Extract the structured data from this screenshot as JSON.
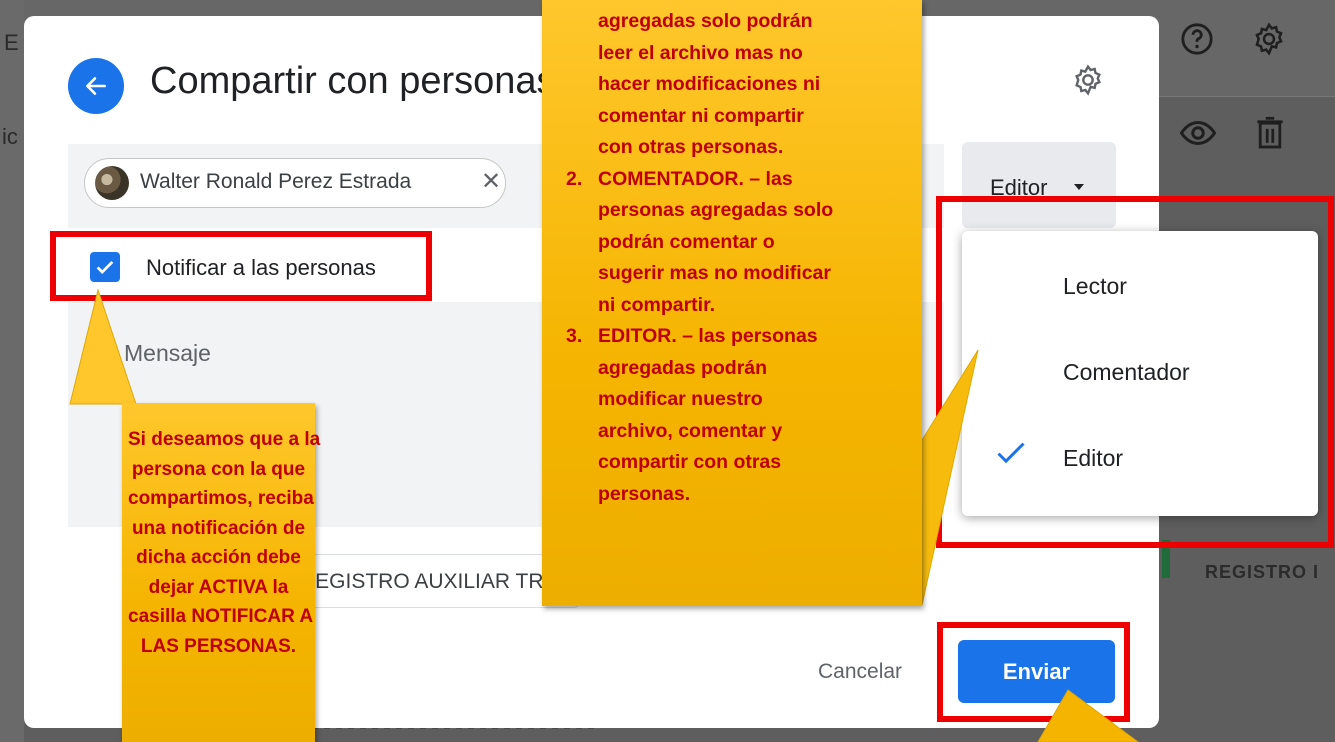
{
  "dialog": {
    "title": "Compartir con personas",
    "recipient_name": "Walter Ronald Perez Estrada",
    "role_value": "Editor",
    "notify_label": "Notificar a las personas",
    "message_placeholder": "Mensaje",
    "attachment_name": "REGISTRO AUXILIAR TRIMESTRE II.docx",
    "cancel_label": "Cancelar",
    "send_label": "Enviar",
    "notify_checked": true
  },
  "role_menu": {
    "items": [
      {
        "label": "Lector",
        "selected": false
      },
      {
        "label": "Comentador",
        "selected": false
      },
      {
        "label": "Editor",
        "selected": true
      }
    ]
  },
  "background": {
    "left_letter_1": "E",
    "left_letter_2": "ic",
    "right_label": "REGISTRO I"
  },
  "annotations": {
    "left_note": [
      "Si deseamos que a la",
      "persona con la que",
      "compartimos, reciba",
      "una notificación de",
      "dicha acción debe",
      "dejar ACTIVA la",
      "casilla NOTIFICAR A",
      "LAS PERSONAS."
    ],
    "center_note": {
      "intro_lines": [
        "agregadas solo podrán",
        "leer el archivo mas no",
        "hacer modificaciones ni",
        "comentar ni compartir",
        "con otras personas."
      ],
      "item2_number": "2.",
      "item2_lines": [
        "COMENTADOR. – las",
        "personas agregadas solo",
        "podrán comentar o",
        "sugerir mas no modificar",
        "ni compartir."
      ],
      "item3_number": "3.",
      "item3_lines": [
        "EDITOR. – las personas",
        "agregadas podrán",
        "modificar nuestro",
        "archivo, comentar y",
        "compartir con otras",
        "personas."
      ]
    }
  },
  "colors": {
    "accent": "#1a73e8",
    "annotation_red": "#ee0000",
    "note_fill": "#f5b400",
    "note_text": "#c00000"
  },
  "icons": [
    "arrow-left-icon",
    "gear-icon",
    "help-icon",
    "eye-icon",
    "trash-icon",
    "close-icon",
    "check-icon",
    "caret-down-icon"
  ]
}
